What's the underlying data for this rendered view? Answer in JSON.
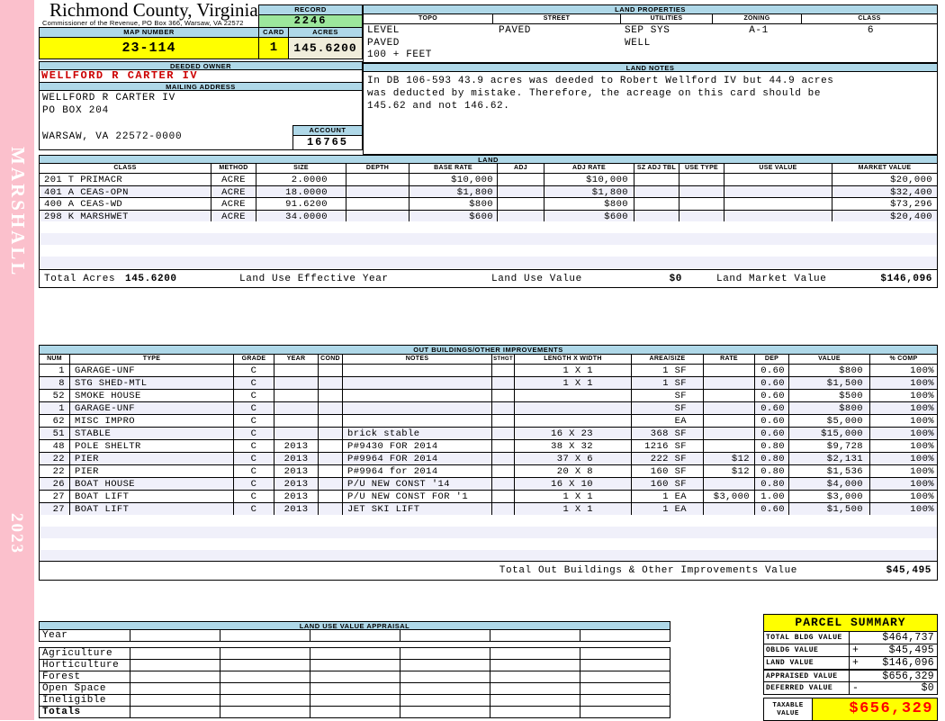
{
  "sidebar": {
    "vendor": "MARSHALL",
    "year": "2023"
  },
  "header": {
    "county": "Richmond County, Virginia",
    "commissioner": "Commissioner of the Revenue, PO Box 366, Warsaw, VA 22572",
    "record_label": "RECORD",
    "record": "2246",
    "map_label": "MAP NUMBER",
    "map_number": "23-114",
    "card_label": "CARD",
    "card": "1",
    "acres_label": "ACRES",
    "acres": "145.6200"
  },
  "land_properties": {
    "title": "LAND PROPERTIES",
    "columns": [
      "TOPO",
      "STREET",
      "UTILITIES",
      "ZONING",
      "CLASS"
    ],
    "topo": "LEVEL\nPAVED\n100 + FEET",
    "street": "PAVED",
    "utilities": "SEP SYS\nWELL",
    "zoning": "A-1",
    "class": "6"
  },
  "owner": {
    "deeded_label": "DEEDED OWNER",
    "name": "WELLFORD R CARTER IV",
    "mailing_label": "MAILING ADDRESS",
    "address_lines": [
      "WELLFORD R CARTER IV",
      "PO BOX 204",
      "WARSAW, VA 22572-0000"
    ],
    "account_label": "ACCOUNT",
    "account": "16765"
  },
  "land_notes": {
    "title": "LAND NOTES",
    "text": "In DB 106-593 43.9 acres was deeded to Robert Wellford IV but 44.9 acres\nwas deducted by mistake. Therefore, the acreage on this card should be\n145.62 and not 146.62."
  },
  "land": {
    "title": "LAND",
    "columns": [
      "CLASS",
      "METHOD",
      "SIZE",
      "DEPTH",
      "BASE RATE",
      "ADJ",
      "ADJ RATE",
      "SZ ADJ TBL",
      "USE TYPE",
      "USE VALUE",
      "MARKET VALUE"
    ],
    "rows": [
      {
        "class": "201 T PRIMACR",
        "method": "ACRE",
        "size": "2.0000",
        "depth": "",
        "base_rate": "$10,000",
        "adj": "",
        "adj_rate": "$10,000",
        "sz_adj_tbl": "",
        "use_type": "",
        "use_value": "",
        "market_value": "$20,000"
      },
      {
        "class": "401 A CEAS-OPN",
        "method": "ACRE",
        "size": "18.0000",
        "depth": "",
        "base_rate": "$1,800",
        "adj": "",
        "adj_rate": "$1,800",
        "sz_adj_tbl": "",
        "use_type": "",
        "use_value": "",
        "market_value": "$32,400"
      },
      {
        "class": "400 A CEAS-WD",
        "method": "ACRE",
        "size": "91.6200",
        "depth": "",
        "base_rate": "$800",
        "adj": "",
        "adj_rate": "$800",
        "sz_adj_tbl": "",
        "use_type": "",
        "use_value": "",
        "market_value": "$73,296"
      },
      {
        "class": "298 K MARSHWET",
        "method": "ACRE",
        "size": "34.0000",
        "depth": "",
        "base_rate": "$600",
        "adj": "",
        "adj_rate": "$600",
        "sz_adj_tbl": "",
        "use_type": "",
        "use_value": "",
        "market_value": "$20,400"
      }
    ],
    "totals": {
      "total_acres_label": "Total Acres",
      "total_acres": "145.6200",
      "effective_year_label": "Land Use Effective Year",
      "use_value_label": "Land Use Value",
      "use_value": "$0",
      "market_value_label": "Land Market Value",
      "market_value": "$146,096"
    }
  },
  "out_buildings": {
    "title": "OUT BUILDINGS/OTHER IMPROVEMENTS",
    "columns": [
      "NUM",
      "TYPE",
      "GRADE",
      "YEAR",
      "COND",
      "NOTES",
      "STHGT",
      "LENGTH X WIDTH",
      "AREA/SIZE",
      "RATE",
      "DEP",
      "VALUE",
      "% COMP"
    ],
    "rows": [
      {
        "num": "1",
        "type": "GARAGE-UNF",
        "grade": "C",
        "year": "",
        "cond": "",
        "notes": "",
        "sthgt": "",
        "lw": "1 X 1",
        "area": "1 SF",
        "rate": "",
        "dep": "0.60",
        "value": "$800",
        "comp": "100%"
      },
      {
        "num": "8",
        "type": "STG SHED-MTL",
        "grade": "C",
        "year": "",
        "cond": "",
        "notes": "",
        "sthgt": "",
        "lw": "1 X 1",
        "area": "1 SF",
        "rate": "",
        "dep": "0.60",
        "value": "$1,500",
        "comp": "100%"
      },
      {
        "num": "52",
        "type": "SMOKE HOUSE",
        "grade": "C",
        "year": "",
        "cond": "",
        "notes": "",
        "sthgt": "",
        "lw": "",
        "area": "SF",
        "rate": "",
        "dep": "0.60",
        "value": "$500",
        "comp": "100%"
      },
      {
        "num": "1",
        "type": "GARAGE-UNF",
        "grade": "C",
        "year": "",
        "cond": "",
        "notes": "",
        "sthgt": "",
        "lw": "",
        "area": "SF",
        "rate": "",
        "dep": "0.60",
        "value": "$800",
        "comp": "100%"
      },
      {
        "num": "62",
        "type": "MISC IMPRO",
        "grade": "C",
        "year": "",
        "cond": "",
        "notes": "",
        "sthgt": "",
        "lw": "",
        "area": "EA",
        "rate": "",
        "dep": "0.60",
        "value": "$5,000",
        "comp": "100%"
      },
      {
        "num": "51",
        "type": "STABLE",
        "grade": "C",
        "year": "",
        "cond": "",
        "notes": "brick stable",
        "sthgt": "",
        "lw": "16 X 23",
        "area": "368 SF",
        "rate": "",
        "dep": "0.60",
        "value": "$15,000",
        "comp": "100%"
      },
      {
        "num": "48",
        "type": "POLE SHELTR",
        "grade": "C",
        "year": "2013",
        "cond": "",
        "notes": "P#9430 FOR 2014",
        "sthgt": "",
        "lw": "38 X 32",
        "area": "1216 SF",
        "rate": "",
        "dep": "0.80",
        "value": "$9,728",
        "comp": "100%"
      },
      {
        "num": "22",
        "type": "PIER",
        "grade": "C",
        "year": "2013",
        "cond": "",
        "notes": "P#9964 FOR 2014",
        "sthgt": "",
        "lw": "37 X 6",
        "area": "222 SF",
        "rate": "$12",
        "dep": "0.80",
        "value": "$2,131",
        "comp": "100%"
      },
      {
        "num": "22",
        "type": "PIER",
        "grade": "C",
        "year": "2013",
        "cond": "",
        "notes": "P#9964 for 2014",
        "sthgt": "",
        "lw": "20 X 8",
        "area": "160 SF",
        "rate": "$12",
        "dep": "0.80",
        "value": "$1,536",
        "comp": "100%"
      },
      {
        "num": "26",
        "type": "BOAT HOUSE",
        "grade": "C",
        "year": "2013",
        "cond": "",
        "notes": "P/U NEW CONST '14",
        "sthgt": "",
        "lw": "16 X 10",
        "area": "160 SF",
        "rate": "",
        "dep": "0.80",
        "value": "$4,000",
        "comp": "100%"
      },
      {
        "num": "27",
        "type": "BOAT LIFT",
        "grade": "C",
        "year": "2013",
        "cond": "",
        "notes": "P/U NEW CONST FOR '1",
        "sthgt": "",
        "lw": "1 X 1",
        "area": "1 EA",
        "rate": "$3,000",
        "dep": "1.00",
        "value": "$3,000",
        "comp": "100%"
      },
      {
        "num": "27",
        "type": "BOAT LIFT",
        "grade": "C",
        "year": "2013",
        "cond": "",
        "notes": "JET SKI LIFT",
        "sthgt": "",
        "lw": "1 X 1",
        "area": "1 EA",
        "rate": "",
        "dep": "0.60",
        "value": "$1,500",
        "comp": "100%"
      }
    ],
    "total_label": "Total Out Buildings & Other Improvements Value",
    "total_value": "$45,495"
  },
  "land_use_appraisal": {
    "title": "LAND USE VALUE APPRAISAL",
    "year_label": "Year",
    "row_labels": [
      "Agriculture",
      "Horticulture",
      "Forest",
      "Open Space",
      "Ineligible",
      "Totals"
    ]
  },
  "parcel_summary": {
    "title": "PARCEL SUMMARY",
    "rows": [
      {
        "label": "TOTAL BLDG VALUE",
        "sign": "",
        "value": "$464,737"
      },
      {
        "label": "OBLDG VALUE",
        "sign": "+",
        "value": "$45,495"
      },
      {
        "label": "LAND VALUE",
        "sign": "+",
        "value": "$146,096"
      },
      {
        "label": "APPRAISED VALUE",
        "sign": "",
        "value": "$656,329"
      },
      {
        "label": "DEFERRED VALUE",
        "sign": "-",
        "value": "$0"
      }
    ],
    "taxable_label": "TAXABLE VALUE",
    "taxable_value": "$656,329"
  },
  "colors": {
    "header_blue": "#afd8e8",
    "record_green": "#9ce79c",
    "highlight_yellow": "#ffff00",
    "acres_beige": "#f0eddb",
    "sidebar_pink": "#fbc0cc",
    "owner_red": "#cc0000",
    "taxable_red": "#ff0000",
    "row_alt": "#f0f0fa"
  }
}
